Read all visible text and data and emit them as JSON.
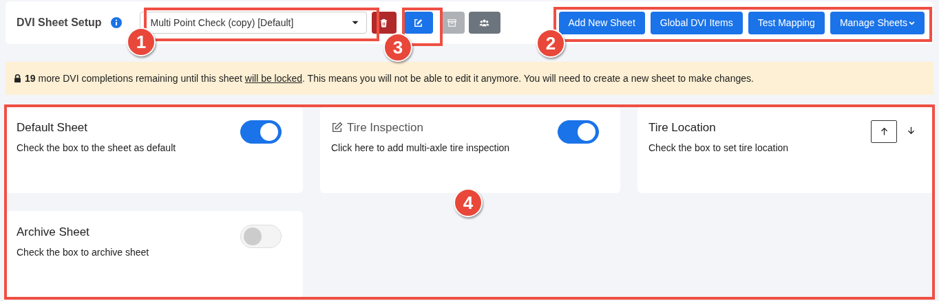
{
  "header": {
    "title": "DVI Sheet Setup",
    "sheet_select": {
      "value": "Multi Point Check (copy) [Default]"
    },
    "icon_buttons": [
      {
        "kind": "delete",
        "disabled": false
      },
      {
        "kind": "edit",
        "disabled": false
      },
      {
        "kind": "archive",
        "disabled": true
      },
      {
        "kind": "group",
        "disabled": false
      }
    ],
    "action_buttons": [
      {
        "label": "Add New Sheet",
        "dropdown": false
      },
      {
        "label": "Global DVI Items",
        "dropdown": false
      },
      {
        "label": "Test Mapping",
        "dropdown": false
      },
      {
        "label": "Manage Sheets",
        "dropdown": true
      }
    ]
  },
  "alert": {
    "before": "**19** more DVI completions remaining until this sheet ",
    "link": "will be locked",
    "after": ". This means you will not be able to edit it anymore. You will need to create a new sheet to make changes."
  },
  "cards": [
    {
      "kind": "toggle",
      "title": "Default Sheet",
      "text": "Check the box to the sheet as default",
      "on": true,
      "editable": false
    },
    {
      "kind": "toggle",
      "title": "Tire Inspection",
      "text": "Click here to add multi-axle tire inspection",
      "on": true,
      "editable": true
    },
    {
      "kind": "order",
      "title": "Tire Location",
      "text": "Check the box to set tire location",
      "editable": false
    },
    {
      "kind": "toggle",
      "title": "Archive Sheet",
      "text": "Check the box to archive sheet",
      "on": false,
      "editable": false
    }
  ],
  "callouts": [
    {
      "number": "1"
    },
    {
      "number": "3"
    },
    {
      "number": "2"
    },
    {
      "number": "4"
    }
  ]
}
